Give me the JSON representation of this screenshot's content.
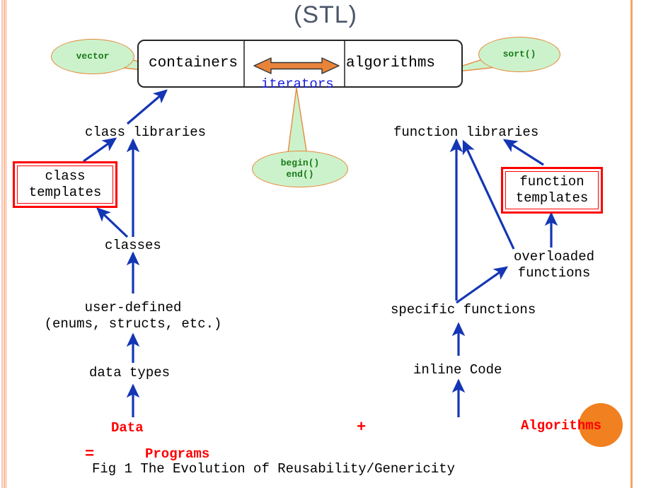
{
  "title": "(STL)",
  "stl_box": {
    "cells": [
      {
        "name": "containers",
        "label": "containers"
      },
      {
        "name": "iterators",
        "label": "iterators"
      },
      {
        "name": "algorithms",
        "label": "algorithms"
      }
    ],
    "arrow_icon": "double-headed-arrow-icon"
  },
  "callouts": [
    {
      "name": "vector",
      "label": "vector"
    },
    {
      "name": "sort",
      "label": "sort()"
    },
    {
      "name": "begin-end",
      "label": "begin()\nend()",
      "line1": "begin()",
      "line2": "end()"
    }
  ],
  "left_branch": {
    "class_libraries": "class libraries",
    "class_templates_line1": "class",
    "class_templates_line2": "templates",
    "classes": "classes",
    "user_defined_line1": "user-defined",
    "user_defined_line2": "(enums, structs, etc.)",
    "data_types": "data types"
  },
  "right_branch": {
    "function_libraries": "function libraries",
    "function_templates_line1": "function",
    "function_templates_line2": "templates",
    "overloaded_line1": "overloaded",
    "overloaded_line2": "functions",
    "specific_functions": "specific functions",
    "inline_code": "inline Code"
  },
  "equation": {
    "data": "Data",
    "plus": "+",
    "algorithms": "Algorithms",
    "equals": "=",
    "programs": "Programs"
  },
  "caption": "Fig 1 The Evolution of Reusability/Genericity",
  "colors": {
    "title": "#4a5568",
    "arrow_blue": "#1436b4",
    "callout_fill": "#ccf2cc",
    "callout_border": "#e8893c",
    "callout_text": "#1a7a1a",
    "iterators_blue": "#1a1ae6",
    "template_border": "#ff0000",
    "equation_red": "#ff0000",
    "orange_dot": "#f08020",
    "double_arrow": "#e8843a",
    "edge_stripe": "#f7a878"
  }
}
